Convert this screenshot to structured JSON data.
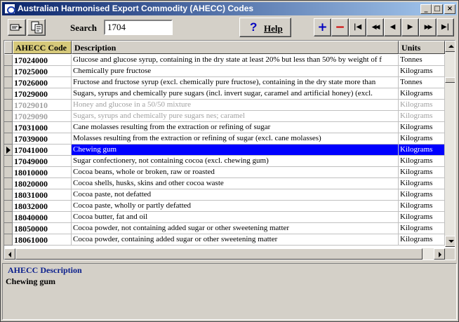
{
  "window": {
    "title": "Australian Harmonised Export Commodity (AHECC) Codes",
    "controls": {
      "minimize": "_",
      "maximize": "□",
      "close": "×"
    }
  },
  "toolbar": {
    "search_label": "Search",
    "search_value": "1704",
    "help_label": "Help",
    "help_glyph": "?",
    "icons": [
      "select-code-icon",
      "copy-code-icon"
    ],
    "nav": {
      "add": "+",
      "remove": "−",
      "first": "|◀",
      "prior_page": "◀◀",
      "prior": "◀",
      "next": "▶",
      "next_page": "▶▶",
      "last": "▶|"
    },
    "colors": {
      "add": "#0000c0",
      "remove": "#d00000"
    }
  },
  "grid": {
    "columns": [
      "AHECC Code",
      "Description",
      "Units"
    ],
    "rows": [
      {
        "code": "17024000",
        "description": "Glucose and glucose syrup, containing in the dry state at least 20% but less than 50% by weight of f",
        "units": "Tonnes",
        "state": "normal"
      },
      {
        "code": "17025000",
        "description": "Chemically pure fructose",
        "units": "Kilograms",
        "state": "normal"
      },
      {
        "code": "17026000",
        "description": "Fructose and fructose syrup (excl. chemically pure fructose), containing in the dry state more than",
        "units": "Tonnes",
        "state": "normal"
      },
      {
        "code": "17029000",
        "description": "Sugars, syrups and chemically pure sugars (incl. invert sugar, caramel and artificial honey) (excl.",
        "units": "Kilograms",
        "state": "normal"
      },
      {
        "code": "17029010",
        "description": "Honey and glucose in a 50/50 mixture",
        "units": "Kilograms",
        "state": "dim"
      },
      {
        "code": "17029090",
        "description": "Sugars, syrups and chemically pure sugars nes; caramel",
        "units": "Kilograms",
        "state": "dim"
      },
      {
        "code": "17031000",
        "description": "Cane molasses resulting from the extraction or refining of sugar",
        "units": "Kilograms",
        "state": "normal"
      },
      {
        "code": "17039000",
        "description": "Molasses resulting from the extraction or refining of sugar (excl. cane molasses)",
        "units": "Kilograms",
        "state": "normal"
      },
      {
        "code": "17041000",
        "description": "Chewing gum",
        "units": "Kilograms",
        "state": "selected"
      },
      {
        "code": "17049000",
        "description": "Sugar confectionery, not containing cocoa (excl. chewing gum)",
        "units": "Kilograms",
        "state": "normal"
      },
      {
        "code": "18010000",
        "description": "Cocoa beans, whole or broken, raw or roasted",
        "units": "Kilograms",
        "state": "normal"
      },
      {
        "code": "18020000",
        "description": "Cocoa shells, husks, skins and other cocoa waste",
        "units": "Kilograms",
        "state": "normal"
      },
      {
        "code": "18031000",
        "description": "Cocoa paste, not defatted",
        "units": "Kilograms",
        "state": "normal"
      },
      {
        "code": "18032000",
        "description": "Cocoa paste, wholly or partly defatted",
        "units": "Kilograms",
        "state": "normal"
      },
      {
        "code": "18040000",
        "description": "Cocoa butter, fat and oil",
        "units": "Kilograms",
        "state": "normal"
      },
      {
        "code": "18050000",
        "description": "Cocoa powder, not containing added sugar or other sweetening matter",
        "units": "Kilograms",
        "state": "normal"
      },
      {
        "code": "18061000",
        "description": "Cocoa powder, containing added sugar or other sweetening matter",
        "units": "Kilograms",
        "state": "normal"
      }
    ],
    "colors": {
      "selection": "#0000ff",
      "code_header": "#d6c97a",
      "dimmed_text": "#a0a0a0"
    }
  },
  "description_panel": {
    "legend": "AHECC Description",
    "value": "Chewing gum"
  }
}
